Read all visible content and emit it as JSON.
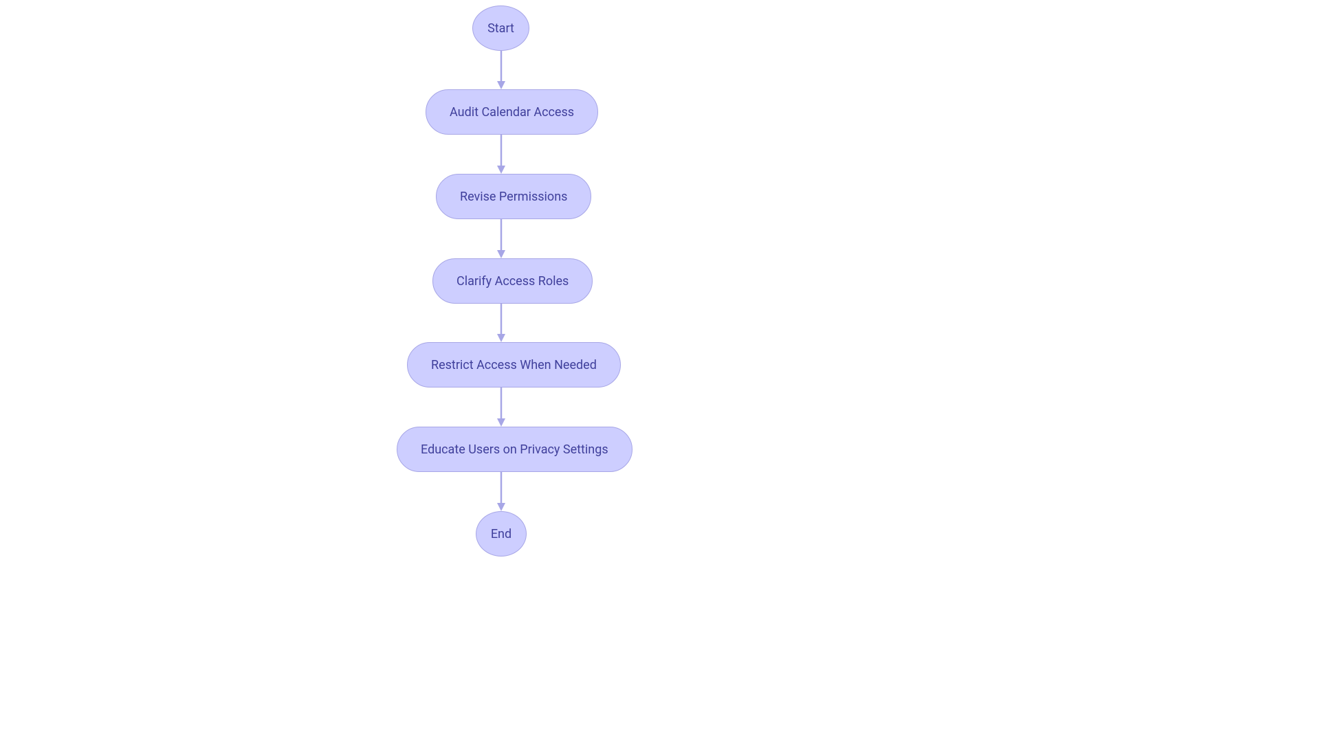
{
  "colors": {
    "node_fill": "#cdceff",
    "node_stroke": "#a7a6e6",
    "text": "#3f3f9b",
    "arrow": "#a7a6e6"
  },
  "nodes": {
    "start": {
      "label": "Start"
    },
    "audit": {
      "label": "Audit Calendar Access"
    },
    "revise": {
      "label": "Revise Permissions"
    },
    "clarify": {
      "label": "Clarify Access Roles"
    },
    "restrict": {
      "label": "Restrict Access When Needed"
    },
    "educate": {
      "label": "Educate Users on Privacy Settings"
    },
    "end": {
      "label": "End"
    }
  },
  "chart_data": {
    "type": "flowchart",
    "direction": "top-to-bottom",
    "nodes": [
      {
        "id": "start",
        "shape": "terminal",
        "label": "Start"
      },
      {
        "id": "audit",
        "shape": "process",
        "label": "Audit Calendar Access"
      },
      {
        "id": "revise",
        "shape": "process",
        "label": "Revise Permissions"
      },
      {
        "id": "clarify",
        "shape": "process",
        "label": "Clarify Access Roles"
      },
      {
        "id": "restrict",
        "shape": "process",
        "label": "Restrict Access When Needed"
      },
      {
        "id": "educate",
        "shape": "process",
        "label": "Educate Users on Privacy Settings"
      },
      {
        "id": "end",
        "shape": "terminal",
        "label": "End"
      }
    ],
    "edges": [
      {
        "from": "start",
        "to": "audit"
      },
      {
        "from": "audit",
        "to": "revise"
      },
      {
        "from": "revise",
        "to": "clarify"
      },
      {
        "from": "clarify",
        "to": "restrict"
      },
      {
        "from": "restrict",
        "to": "educate"
      },
      {
        "from": "educate",
        "to": "end"
      }
    ]
  }
}
